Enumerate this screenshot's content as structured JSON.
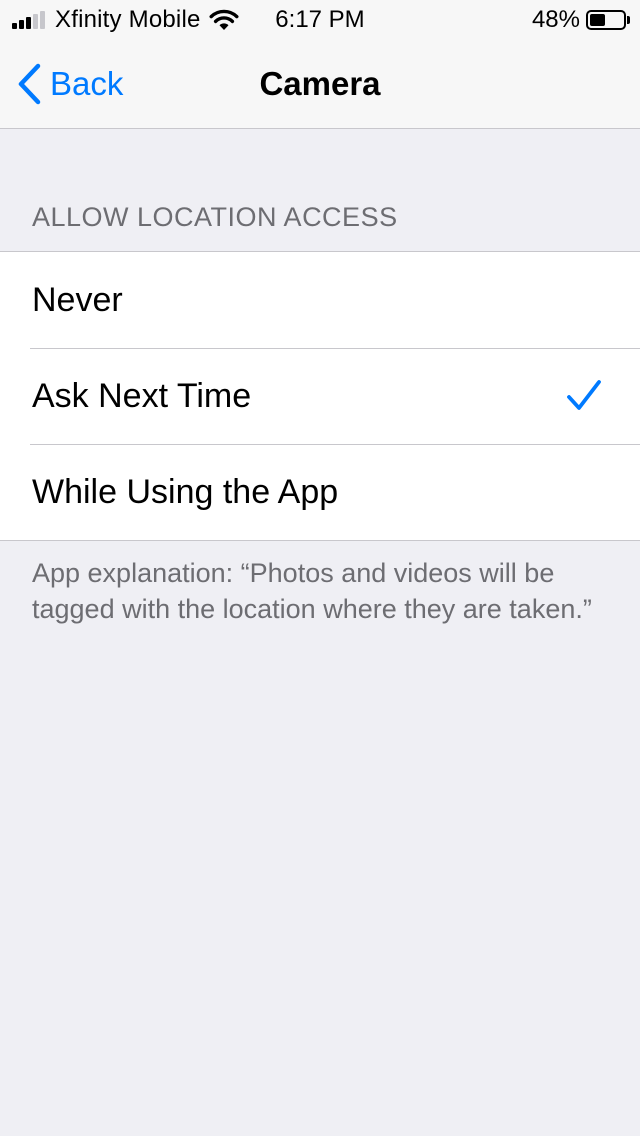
{
  "status_bar": {
    "carrier": "Xfinity Mobile",
    "time": "6:17 PM",
    "battery_percent": "48%",
    "battery_level": 0.48,
    "signal_strength": 3,
    "signal_max": 5,
    "icons": [
      "signal-icon",
      "wifi-icon",
      "battery-icon"
    ]
  },
  "nav": {
    "back_label": "Back",
    "title": "Camera",
    "accent_color": "#007aff"
  },
  "section": {
    "header": "ALLOW LOCATION ACCESS",
    "options": [
      {
        "label": "Never",
        "selected": false
      },
      {
        "label": "Ask Next Time",
        "selected": true
      },
      {
        "label": "While Using the App",
        "selected": false
      }
    ]
  },
  "footer": {
    "explanation": "App explanation: “Photos and videos will be tagged with the location where they are taken.”"
  }
}
